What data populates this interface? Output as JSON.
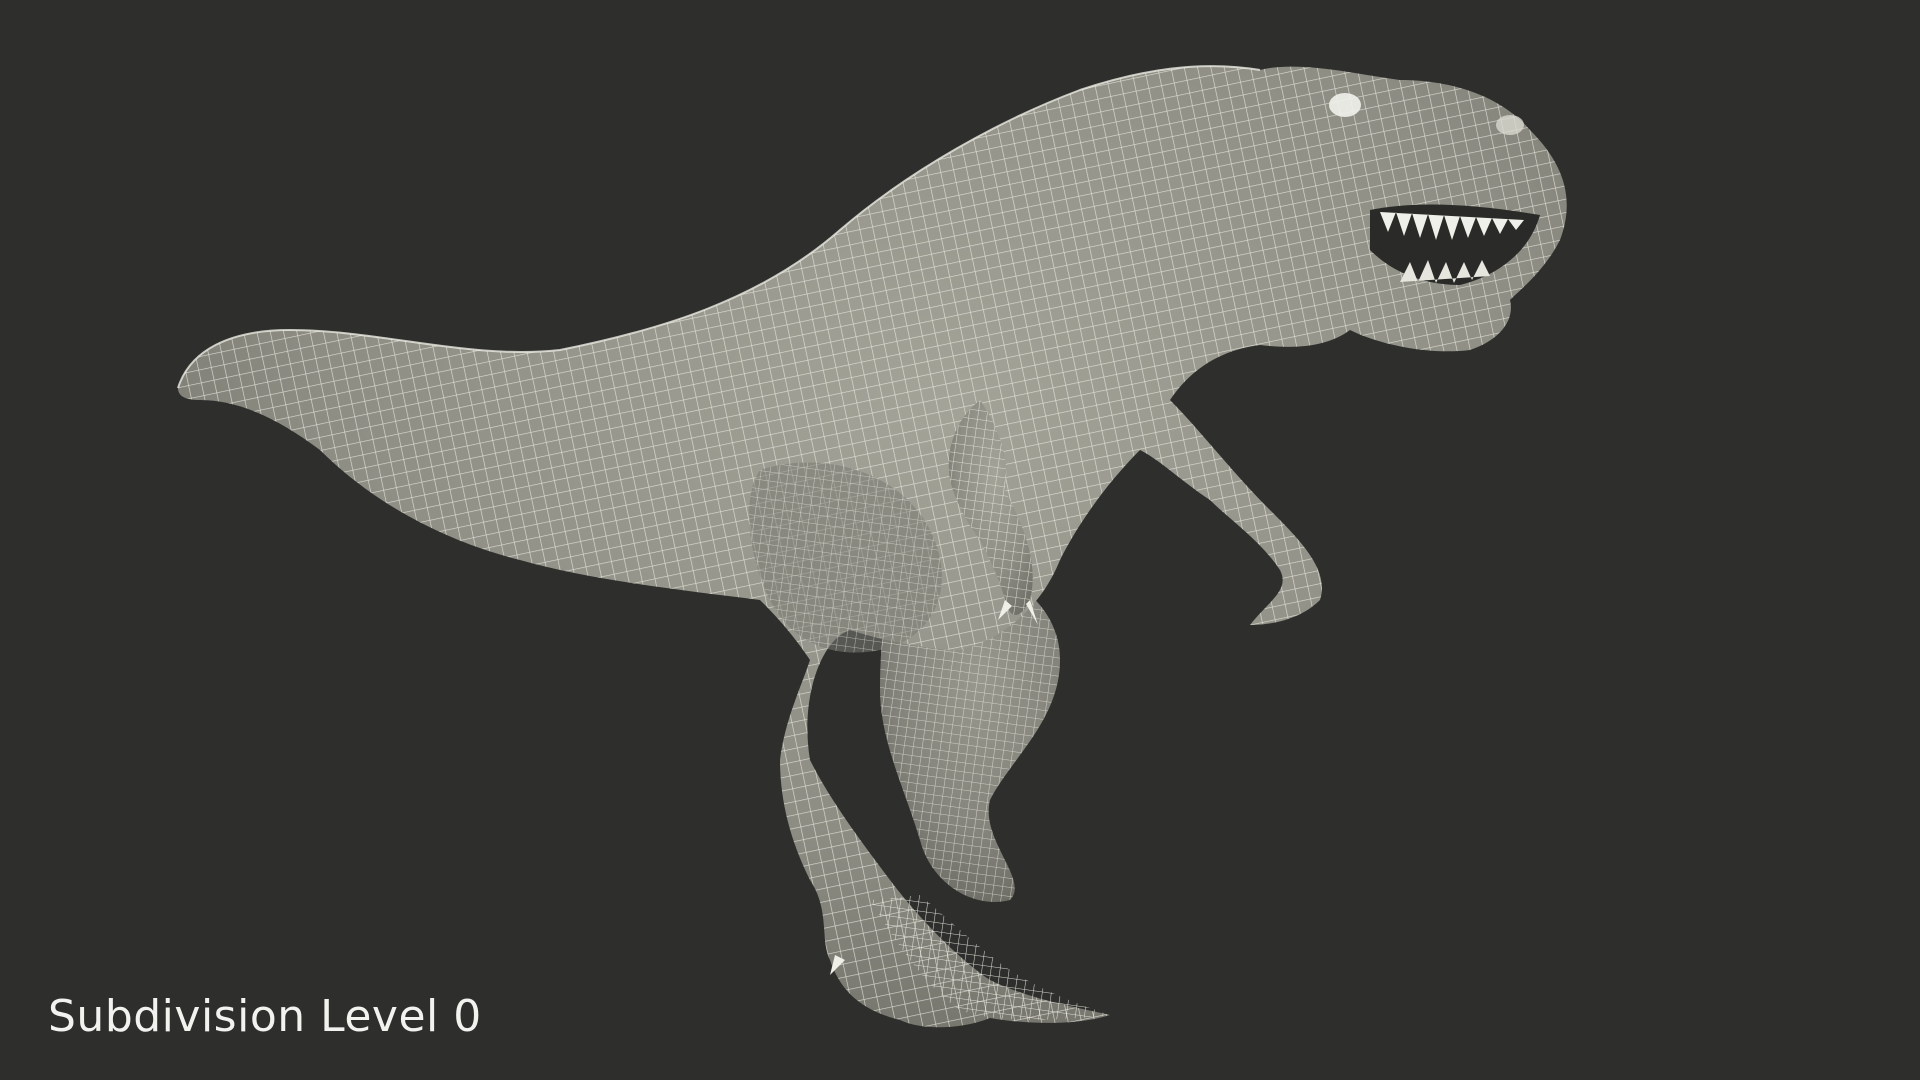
{
  "scene": {
    "background_color": "#2e2e2d",
    "model_color": "#8d8d84",
    "wire_color": "#e9e9e1",
    "subject_icon": "t-rex-wireframe-icon"
  },
  "caption": {
    "text": "Subdivision Level 0"
  }
}
